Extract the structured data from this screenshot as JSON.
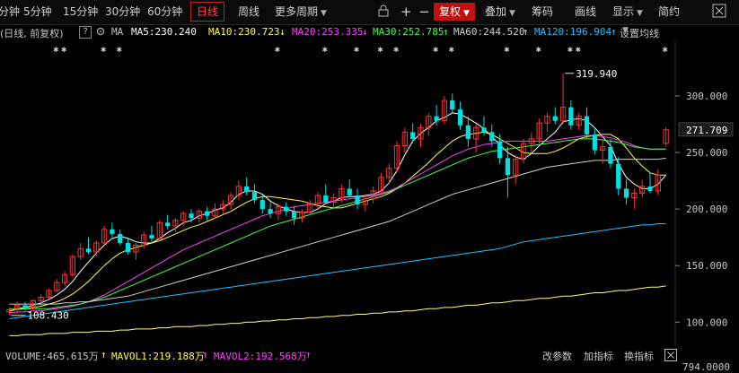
{
  "toolbar": {
    "minute": "分钟",
    "min5": "5分钟",
    "min15": "15分钟",
    "min30": "30分钟",
    "min60": "60分钟",
    "day": "日线",
    "week": "周线",
    "more_periods": "更多周期",
    "plus": "+",
    "minus": "−",
    "fq": "复权",
    "overlay": "叠加",
    "chips": "筹码",
    "draw": "画线",
    "display": "显示",
    "brief": "简约"
  },
  "legend": {
    "period": "(日线, 前复权)",
    "help": "?",
    "ma_label": "MA",
    "ma5": "MA5:230.240",
    "ma10": "MA10:230.723",
    "ma10_arrow": "↓",
    "ma20": "MA20:253.335",
    "ma20_arrow": "↓",
    "ma30": "MA30:252.785",
    "ma30_arrow": "↑",
    "ma60": "MA60:244.520",
    "ma60_arrow": "↑",
    "ma120": "MA120:196.904",
    "ma120_arrow": "↑",
    "settings": "设置均线"
  },
  "markers": {
    "high": "319.940",
    "low": "108.430",
    "last": "271.709",
    "star_text": "✱"
  },
  "bottom": {
    "volume": "VOLUME:465.615万",
    "mavol1": "MAVOL1:219.188万",
    "mavol2": "MAVOL2:192.568万",
    "change_params": "改参数",
    "add_indicator": "加指标",
    "switch_indicator": "换指标",
    "vol_axis": "794.0000"
  },
  "colors": {
    "up": "#ff3030",
    "down": "#00e0e0",
    "ma5": "#ffffff",
    "ma10": "#ffff40",
    "ma20": "#ff40ff",
    "ma30": "#40ff40",
    "ma60": "#d0d0d0",
    "ma120": "#20c0ff",
    "ma250": "#ffff80"
  },
  "chart_data": {
    "type": "candlestick",
    "y_ticks": [
      "300.000",
      "250.000",
      "200.000",
      "150.000",
      "100.000"
    ],
    "y_tick_values": [
      300,
      250,
      200,
      150,
      100
    ],
    "ylim": [
      82,
      342
    ],
    "candles": [
      [
        109,
        113,
        106,
        111
      ],
      [
        111,
        118,
        108,
        115
      ],
      [
        115,
        118,
        110,
        112
      ],
      [
        112,
        120,
        111,
        119
      ],
      [
        119,
        125,
        117,
        122
      ],
      [
        122,
        130,
        120,
        128
      ],
      [
        128,
        138,
        126,
        135
      ],
      [
        135,
        145,
        132,
        142
      ],
      [
        142,
        160,
        140,
        158
      ],
      [
        158,
        170,
        155,
        165
      ],
      [
        165,
        175,
        160,
        162
      ],
      [
        162,
        172,
        158,
        170
      ],
      [
        170,
        185,
        168,
        182
      ],
      [
        182,
        188,
        175,
        178
      ],
      [
        178,
        182,
        168,
        170
      ],
      [
        170,
        175,
        160,
        162
      ],
      [
        162,
        170,
        155,
        168
      ],
      [
        168,
        180,
        165,
        177
      ],
      [
        177,
        185,
        170,
        174
      ],
      [
        174,
        190,
        172,
        188
      ],
      [
        188,
        195,
        182,
        185
      ],
      [
        185,
        192,
        180,
        190
      ],
      [
        190,
        198,
        185,
        196
      ],
      [
        196,
        200,
        188,
        192
      ],
      [
        192,
        200,
        188,
        198
      ],
      [
        198,
        202,
        190,
        194
      ],
      [
        194,
        205,
        192,
        200
      ],
      [
        200,
        208,
        195,
        204
      ],
      [
        204,
        215,
        200,
        212
      ],
      [
        212,
        225,
        208,
        220
      ],
      [
        220,
        228,
        212,
        215
      ],
      [
        215,
        222,
        205,
        208
      ],
      [
        208,
        212,
        196,
        200
      ],
      [
        200,
        206,
        192,
        196
      ],
      [
        196,
        205,
        190,
        202
      ],
      [
        202,
        206,
        194,
        198
      ],
      [
        198,
        202,
        186,
        192
      ],
      [
        192,
        200,
        188,
        197
      ],
      [
        197,
        208,
        194,
        205
      ],
      [
        205,
        215,
        200,
        212
      ],
      [
        212,
        222,
        208,
        206
      ],
      [
        206,
        214,
        200,
        210
      ],
      [
        210,
        222,
        206,
        218
      ],
      [
        218,
        226,
        210,
        212
      ],
      [
        212,
        218,
        200,
        204
      ],
      [
        204,
        212,
        198,
        209
      ],
      [
        209,
        220,
        205,
        216
      ],
      [
        216,
        232,
        212,
        228
      ],
      [
        228,
        240,
        222,
        236
      ],
      [
        236,
        260,
        232,
        256
      ],
      [
        256,
        272,
        250,
        268
      ],
      [
        268,
        276,
        258,
        262
      ],
      [
        262,
        275,
        255,
        272
      ],
      [
        272,
        285,
        265,
        282
      ],
      [
        282,
        292,
        274,
        278
      ],
      [
        278,
        300,
        275,
        296
      ],
      [
        296,
        302,
        285,
        288
      ],
      [
        288,
        295,
        270,
        274
      ],
      [
        274,
        282,
        255,
        262
      ],
      [
        262,
        275,
        250,
        272
      ],
      [
        272,
        282,
        265,
        268
      ],
      [
        268,
        275,
        255,
        260
      ],
      [
        260,
        266,
        240,
        245
      ],
      [
        245,
        255,
        210,
        230
      ],
      [
        230,
        248,
        222,
        244
      ],
      [
        244,
        262,
        240,
        258
      ],
      [
        258,
        268,
        250,
        262
      ],
      [
        262,
        280,
        258,
        276
      ],
      [
        276,
        285,
        268,
        282
      ],
      [
        282,
        290,
        275,
        278
      ],
      [
        278,
        320,
        275,
        290
      ],
      [
        290,
        296,
        270,
        274
      ],
      [
        274,
        285,
        270,
        282
      ],
      [
        282,
        290,
        262,
        266
      ],
      [
        266,
        272,
        248,
        252
      ],
      [
        252,
        262,
        240,
        255
      ],
      [
        255,
        262,
        236,
        240
      ],
      [
        240,
        246,
        212,
        218
      ],
      [
        218,
        226,
        204,
        210
      ],
      [
        210,
        218,
        200,
        214
      ],
      [
        214,
        226,
        210,
        220
      ],
      [
        220,
        232,
        214,
        216
      ],
      [
        216,
        235,
        212,
        230
      ],
      [
        258,
        272,
        255,
        270
      ]
    ],
    "ma_series": [
      {
        "name": "MA5",
        "color_key": "ma5",
        "values": [
          110,
          112,
          113,
          115,
          117,
          120,
          124,
          129,
          136,
          145,
          153,
          161,
          168,
          174,
          176,
          174,
          171,
          170,
          170,
          174,
          179,
          183,
          188,
          190,
          194,
          196,
          199,
          201,
          206,
          213,
          216,
          216,
          213,
          207,
          203,
          200,
          198,
          197,
          197,
          200,
          205,
          207,
          210,
          211,
          211,
          212,
          213,
          216,
          223,
          234,
          248,
          260,
          267,
          272,
          278,
          281,
          285,
          284,
          280,
          276,
          271,
          264,
          257,
          250,
          246,
          244,
          249,
          256,
          262,
          268,
          277,
          279,
          280,
          278,
          272,
          264,
          256,
          240,
          228,
          222,
          218,
          218,
          222,
          230
        ]
      },
      {
        "name": "MA10",
        "color_key": "ma10",
        "values": [
          110,
          111,
          112,
          113,
          114,
          116,
          118,
          121,
          125,
          130,
          136,
          143,
          150,
          156,
          161,
          164,
          166,
          168,
          170,
          172,
          175,
          178,
          181,
          184,
          186,
          189,
          192,
          195,
          198,
          202,
          206,
          209,
          211,
          211,
          210,
          209,
          208,
          207,
          205,
          203,
          202,
          201,
          201,
          203,
          205,
          207,
          209,
          211,
          214,
          218,
          223,
          229,
          235,
          241,
          248,
          254,
          260,
          264,
          266,
          267,
          268,
          266,
          262,
          258,
          254,
          250,
          249,
          249,
          249,
          251,
          254,
          258,
          262,
          264,
          265,
          266,
          266,
          262,
          254,
          245,
          238,
          232,
          230,
          230
        ]
      },
      {
        "name": "MA20",
        "color_key": "ma20",
        "values": [
          108,
          109,
          109,
          110,
          110,
          111,
          112,
          113,
          114,
          116,
          118,
          121,
          124,
          128,
          132,
          136,
          140,
          144,
          148,
          152,
          156,
          160,
          164,
          167,
          170,
          173,
          176,
          179,
          182,
          185,
          188,
          191,
          194,
          196,
          198,
          200,
          202,
          203,
          204,
          205,
          206,
          207,
          208,
          209,
          210,
          211,
          212,
          214,
          216,
          219,
          223,
          227,
          231,
          235,
          239,
          243,
          247,
          250,
          253,
          255,
          257,
          258,
          259,
          260,
          260,
          260,
          260,
          260,
          260,
          261,
          262,
          263,
          264,
          265,
          265,
          264,
          263,
          261,
          259,
          256,
          254,
          253,
          253,
          253
        ]
      },
      {
        "name": "MA30",
        "color_key": "ma30",
        "values": [
          112,
          112,
          112,
          112,
          112,
          112,
          113,
          114,
          115,
          116,
          118,
          120,
          122,
          125,
          128,
          131,
          134,
          137,
          140,
          143,
          146,
          149,
          152,
          155,
          158,
          161,
          164,
          167,
          170,
          173,
          176,
          179,
          182,
          185,
          187,
          189,
          191,
          193,
          195,
          197,
          199,
          201,
          203,
          205,
          207,
          209,
          211,
          213,
          215,
          218,
          221,
          224,
          227,
          230,
          233,
          236,
          239,
          242,
          245,
          247,
          249,
          251,
          252,
          253,
          254,
          255,
          256,
          257,
          258,
          259,
          260,
          261,
          262,
          262,
          262,
          261,
          260,
          259,
          257,
          255,
          254,
          253,
          253,
          253
        ]
      },
      {
        "name": "MA60",
        "color_key": "ma60",
        "values": [
          116,
          116,
          116,
          116,
          116,
          116,
          116,
          117,
          117,
          118,
          118,
          119,
          120,
          121,
          122,
          123,
          125,
          127,
          129,
          131,
          133,
          135,
          137,
          139,
          141,
          143,
          145,
          147,
          149,
          151,
          153,
          155,
          157,
          159,
          161,
          163,
          165,
          167,
          169,
          171,
          173,
          175,
          177,
          179,
          181,
          183,
          185,
          187,
          189,
          192,
          195,
          198,
          201,
          204,
          207,
          210,
          213,
          215,
          217,
          219,
          221,
          223,
          225,
          227,
          229,
          231,
          233,
          235,
          237,
          238,
          239,
          240,
          241,
          242,
          243,
          243,
          243,
          244,
          244,
          244,
          244,
          244,
          244,
          245
        ]
      },
      {
        "name": "MA120",
        "color_key": "ma120",
        "values": [
          103,
          104,
          105,
          106,
          107,
          108,
          109,
          110,
          111,
          112,
          113,
          114,
          115,
          116,
          117,
          118,
          119,
          120,
          121,
          122,
          123,
          124,
          125,
          126,
          127,
          128,
          129,
          130,
          131,
          132,
          133,
          134,
          135,
          136,
          137,
          138,
          139,
          140,
          141,
          142,
          143,
          144,
          145,
          146,
          147,
          148,
          149,
          150,
          151,
          152,
          153,
          154,
          155,
          156,
          157,
          158,
          159,
          160,
          161,
          162,
          163,
          164,
          165,
          167,
          169,
          171,
          172,
          173,
          174,
          175,
          176,
          177,
          178,
          179,
          180,
          181,
          182,
          183,
          184,
          185,
          186,
          186,
          187,
          187
        ]
      },
      {
        "name": "MA250",
        "color_key": "ma250",
        "values": [
          88,
          88,
          89,
          89,
          89,
          90,
          90,
          90,
          91,
          91,
          91,
          92,
          92,
          92,
          93,
          93,
          94,
          94,
          94,
          95,
          95,
          96,
          96,
          96,
          97,
          97,
          98,
          98,
          99,
          99,
          100,
          100,
          101,
          101,
          102,
          102,
          103,
          103,
          104,
          104,
          105,
          105,
          106,
          106,
          107,
          107,
          108,
          108,
          109,
          109,
          110,
          110,
          111,
          112,
          112,
          113,
          113,
          114,
          115,
          115,
          116,
          117,
          117,
          118,
          119,
          119,
          120,
          121,
          121,
          122,
          123,
          123,
          124,
          125,
          126,
          126,
          127,
          128,
          128,
          129,
          130,
          131,
          131,
          132
        ]
      }
    ],
    "star_candles": [
      6,
      7,
      12,
      14,
      34,
      40,
      44,
      47,
      49,
      54,
      56,
      63,
      67,
      71,
      72,
      83
    ]
  }
}
